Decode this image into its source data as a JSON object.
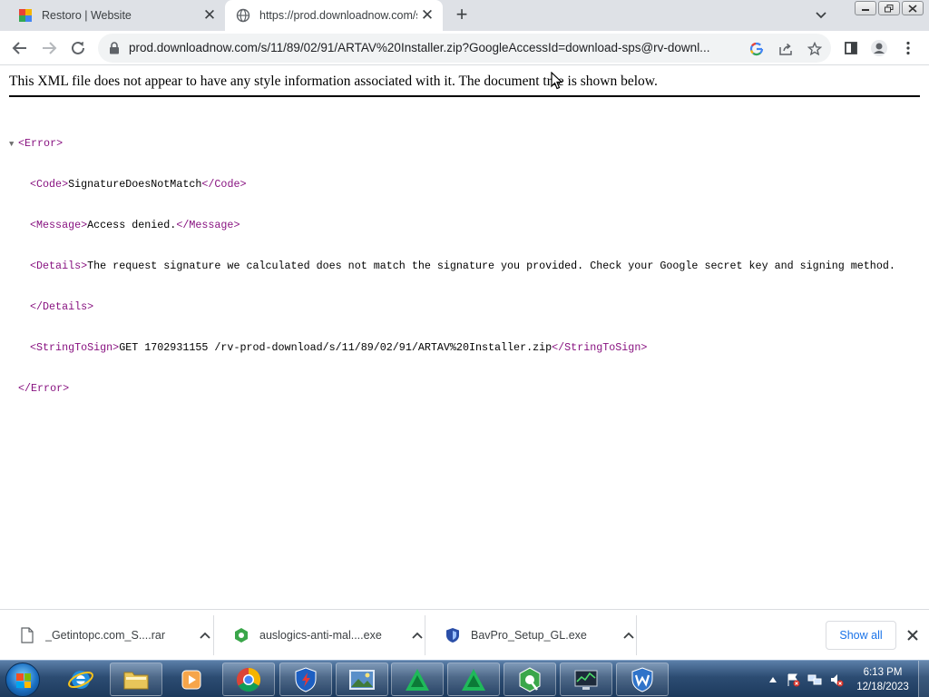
{
  "browser": {
    "tabs": [
      {
        "title": "Restoro | Website",
        "favicon": "restoro-icon",
        "active": false
      },
      {
        "title": "https://prod.downloadnow.com/s/11/89/02/91/ARTAV%20Installer.zip",
        "favicon": "globe-icon",
        "active": true
      }
    ],
    "url": "prod.downloadnow.com/s/11/89/02/91/ARTAV%20Installer.zip?GoogleAccessId=download-sps@rv-downl..."
  },
  "page": {
    "xml_info": "This XML file does not appear to have any style information associated with it. The document tree is shown below.",
    "error_open": "<Error>",
    "code_open": "<Code>",
    "code_value": "SignatureDoesNotMatch",
    "code_close": "</Code>",
    "message_open": "<Message>",
    "message_value": "Access denied.",
    "message_close": "</Message>",
    "details_open": "<Details>",
    "details_value": "The request signature we calculated does not match the signature you provided. Check your Google secret key and signing method.",
    "details_close": "</Details>",
    "sts_open": "<StringToSign>",
    "sts_value": "GET 1702931155 /rv-prod-download/s/11/89/02/91/ARTAV%20Installer.zip",
    "sts_close": "</StringToSign>",
    "error_close": "</Error>"
  },
  "downloads": {
    "items": [
      {
        "name": "_Getintopc.com_S....rar",
        "icon": "file-icon"
      },
      {
        "name": "auslogics-anti-mal....exe",
        "icon": "auslogics-icon"
      },
      {
        "name": "BavPro_Setup_GL.exe",
        "icon": "shield-icon"
      }
    ],
    "show_all": "Show all"
  },
  "taskbar": {
    "time": "6:13 PM",
    "date": "12/18/2023"
  },
  "colors": {
    "xml_tag": "#881280",
    "link_blue": "#1a73e8",
    "tabstrip_bg": "#dee1e6"
  }
}
